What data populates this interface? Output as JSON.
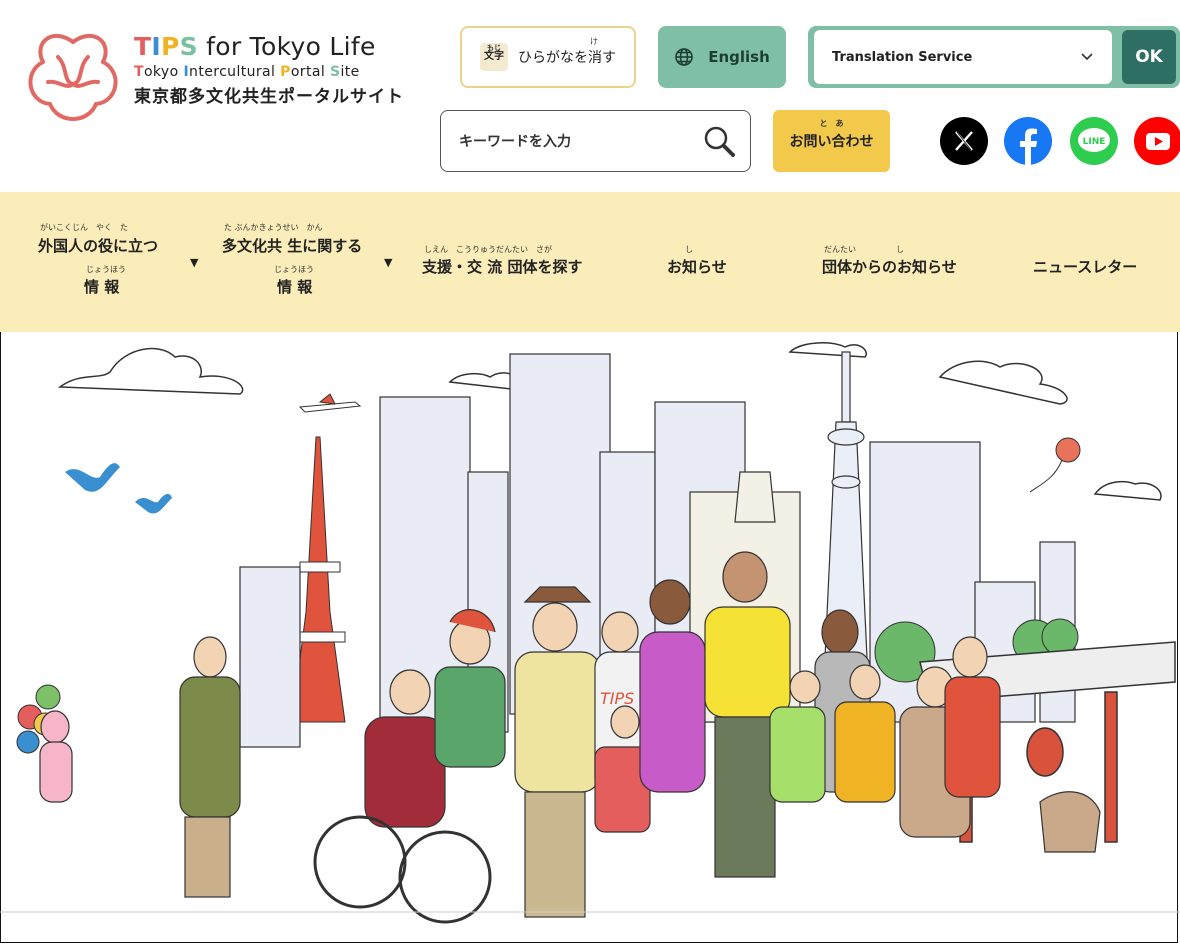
{
  "header": {
    "brand_title_parts": [
      "T",
      "I",
      "P",
      "S",
      " for Tokyo Life"
    ],
    "brand_sub_parts": [
      "T",
      "okyo ",
      "I",
      "ntercultural ",
      "P",
      "ortal ",
      "S",
      "ite"
    ],
    "brand_jp": "東京都多文化共生ポータルサイト",
    "hiragana_icon_text": "文字",
    "hiragana_icon_ruby": "もじ",
    "hiragana_button": "ひらがなを消す",
    "hiragana_button_ruby": "け",
    "english_button": "English",
    "translation_select": "Translation Service",
    "ok_button": "OK",
    "search_placeholder": "キーワードを入力",
    "contact_button": "お問い合わせ",
    "contact_ruby": "と　あ",
    "sns": [
      {
        "name": "x-icon",
        "color": "#000000"
      },
      {
        "name": "facebook-icon",
        "color": "#1877f2"
      },
      {
        "name": "line-icon",
        "color": "#2ecc4f",
        "label": "LINE"
      },
      {
        "name": "youtube-icon",
        "color": "#ff0000"
      }
    ]
  },
  "nav": {
    "items": [
      {
        "ruby1": "がいこくじん　やく　た",
        "line1": "外国人の役に立つ",
        "ruby2": "じょうほう",
        "line2": "情 報"
      },
      {
        "ruby1": "た ぶんかきょうせい　かん",
        "line1": "多文化共 生に関する",
        "ruby2": "じょうほう",
        "line2": "情 報"
      },
      {
        "ruby1": "しえん　こうりゅうだんたい　さが",
        "line1": "支援・交 流 団体を探す"
      },
      {
        "ruby1": "し",
        "line1": "お知らせ"
      },
      {
        "ruby1": "だんたい　　　　　し",
        "line1": "団体からのお知らせ"
      },
      {
        "line1": "ニュースレター"
      }
    ],
    "caret": "▼"
  },
  "hero": {
    "shirt_text": "TIPS",
    "colors": {
      "sky": "#ffffff",
      "building_fill": "#e9ecf5",
      "tower": "#e0533c",
      "skytree": "#e9eef7"
    }
  }
}
